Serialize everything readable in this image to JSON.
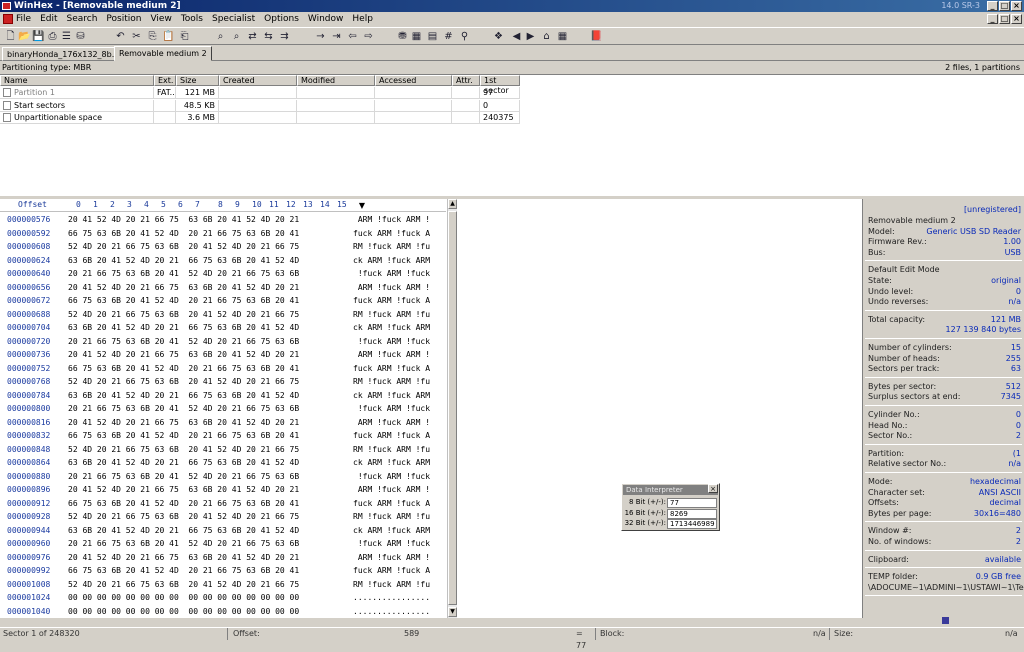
{
  "window": {
    "title": "WinHex - [Removable medium 2]",
    "version": "14.0 SR-3",
    "min": "_",
    "max": "□",
    "close": "×"
  },
  "menu": [
    "File",
    "Edit",
    "Search",
    "Position",
    "View",
    "Tools",
    "Specialist",
    "Options",
    "Window",
    "Help"
  ],
  "toolbar": [
    "new-icon",
    "open-icon",
    "save-icon",
    "print-icon",
    "properties-icon",
    "open-disk-icon",
    "undo-icon",
    "cut-icon",
    "copy-icon",
    "paste-icon",
    "paste-special-icon",
    "find-icon",
    "find-hex-icon",
    "replace-icon",
    "replace-hex-icon",
    "find-next-icon",
    "goto-offset-icon",
    "goto-sector-icon",
    "goto-back-icon",
    "goto-forward-icon",
    "disk-editor-icon",
    "ram-editor-icon",
    "calculator-icon",
    "hash-icon",
    "explore-icon",
    "snapshot-icon",
    "prev-sector-icon",
    "next-sector-icon",
    "home-icon",
    "table-icon",
    "help-book-icon"
  ],
  "tabs": [
    {
      "label": "binaryHonda_176x132_8b.BIN"
    },
    {
      "label": "Removable medium 2"
    }
  ],
  "partition": {
    "type": "Partitioning type: MBR",
    "count": "2 files, 1 partitions"
  },
  "filelist": {
    "headers": [
      "Name",
      "Ext.",
      "Size",
      "Created",
      "Modified",
      "Accessed",
      "Attr.",
      "1st sector"
    ],
    "rows": [
      {
        "name": "Partition 1",
        "ext": "FAT...",
        "size": "121 MB",
        "created": "",
        "modified": "",
        "accessed": "",
        "attr": "",
        "sector": "97"
      },
      {
        "name": "Start sectors",
        "ext": "",
        "size": "48.5 KB",
        "created": "",
        "modified": "",
        "accessed": "",
        "attr": "",
        "sector": "0"
      },
      {
        "name": "Unpartitionable space",
        "ext": "",
        "size": "3.6 MB",
        "created": "",
        "modified": "",
        "accessed": "",
        "attr": "",
        "sector": "240375"
      }
    ]
  },
  "hex": {
    "offset_label": "Offset",
    "col_labels": [
      "0",
      "1",
      "2",
      "3",
      "4",
      "5",
      "6",
      "7",
      "8",
      "9",
      "10",
      "11",
      "12",
      "13",
      "14",
      "15"
    ],
    "rows": [
      {
        "off": "000000576",
        "hex": "20 41 52 4D 20 21 66 75  63 6B 20 41 52 4D 20 21",
        "txt": " ARM !fuck ARM !"
      },
      {
        "off": "000000592",
        "hex": "66 75 63 6B 20 41 52 4D  20 21 66 75 63 6B 20 41",
        "txt": "fuck ARM !fuck A"
      },
      {
        "off": "000000608",
        "hex": "52 4D 20 21 66 75 63 6B  20 41 52 4D 20 21 66 75",
        "txt": "RM !fuck ARM !fu"
      },
      {
        "off": "000000624",
        "hex": "63 6B 20 41 52 4D 20 21  66 75 63 6B 20 41 52 4D",
        "txt": "ck ARM !fuck ARM"
      },
      {
        "off": "000000640",
        "hex": "20 21 66 75 63 6B 20 41  52 4D 20 21 66 75 63 6B",
        "txt": " !fuck ARM !fuck"
      },
      {
        "off": "000000656",
        "hex": "20 41 52 4D 20 21 66 75  63 6B 20 41 52 4D 20 21",
        "txt": " ARM !fuck ARM !"
      },
      {
        "off": "000000672",
        "hex": "66 75 63 6B 20 41 52 4D  20 21 66 75 63 6B 20 41",
        "txt": "fuck ARM !fuck A"
      },
      {
        "off": "000000688",
        "hex": "52 4D 20 21 66 75 63 6B  20 41 52 4D 20 21 66 75",
        "txt": "RM !fuck ARM !fu"
      },
      {
        "off": "000000704",
        "hex": "63 6B 20 41 52 4D 20 21  66 75 63 6B 20 41 52 4D",
        "txt": "ck ARM !fuck ARM"
      },
      {
        "off": "000000720",
        "hex": "20 21 66 75 63 6B 20 41  52 4D 20 21 66 75 63 6B",
        "txt": " !fuck ARM !fuck"
      },
      {
        "off": "000000736",
        "hex": "20 41 52 4D 20 21 66 75  63 6B 20 41 52 4D 20 21",
        "txt": " ARM !fuck ARM !"
      },
      {
        "off": "000000752",
        "hex": "66 75 63 6B 20 41 52 4D  20 21 66 75 63 6B 20 41",
        "txt": "fuck ARM !fuck A"
      },
      {
        "off": "000000768",
        "hex": "52 4D 20 21 66 75 63 6B  20 41 52 4D 20 21 66 75",
        "txt": "RM !fuck ARM !fu"
      },
      {
        "off": "000000784",
        "hex": "63 6B 20 41 52 4D 20 21  66 75 63 6B 20 41 52 4D",
        "txt": "ck ARM !fuck ARM"
      },
      {
        "off": "000000800",
        "hex": "20 21 66 75 63 6B 20 41  52 4D 20 21 66 75 63 6B",
        "txt": " !fuck ARM !fuck"
      },
      {
        "off": "000000816",
        "hex": "20 41 52 4D 20 21 66 75  63 6B 20 41 52 4D 20 21",
        "txt": " ARM !fuck ARM !"
      },
      {
        "off": "000000832",
        "hex": "66 75 63 6B 20 41 52 4D  20 21 66 75 63 6B 20 41",
        "txt": "fuck ARM !fuck A"
      },
      {
        "off": "000000848",
        "hex": "52 4D 20 21 66 75 63 6B  20 41 52 4D 20 21 66 75",
        "txt": "RM !fuck ARM !fu"
      },
      {
        "off": "000000864",
        "hex": "63 6B 20 41 52 4D 20 21  66 75 63 6B 20 41 52 4D",
        "txt": "ck ARM !fuck ARM"
      },
      {
        "off": "000000880",
        "hex": "20 21 66 75 63 6B 20 41  52 4D 20 21 66 75 63 6B",
        "txt": " !fuck ARM !fuck"
      },
      {
        "off": "000000896",
        "hex": "20 41 52 4D 20 21 66 75  63 6B 20 41 52 4D 20 21",
        "txt": " ARM !fuck ARM !"
      },
      {
        "off": "000000912",
        "hex": "66 75 63 6B 20 41 52 4D  20 21 66 75 63 6B 20 41",
        "txt": "fuck ARM !fuck A"
      },
      {
        "off": "000000928",
        "hex": "52 4D 20 21 66 75 63 6B  20 41 52 4D 20 21 66 75",
        "txt": "RM !fuck ARM !fu"
      },
      {
        "off": "000000944",
        "hex": "63 6B 20 41 52 4D 20 21  66 75 63 6B 20 41 52 4D",
        "txt": "ck ARM !fuck ARM"
      },
      {
        "off": "000000960",
        "hex": "20 21 66 75 63 6B 20 41  52 4D 20 21 66 75 63 6B",
        "txt": " !fuck ARM !fuck"
      },
      {
        "off": "000000976",
        "hex": "20 41 52 4D 20 21 66 75  63 6B 20 41 52 4D 20 21",
        "txt": " ARM !fuck ARM !"
      },
      {
        "off": "000000992",
        "hex": "66 75 63 6B 20 41 52 4D  20 21 66 75 63 6B 20 41",
        "txt": "fuck ARM !fuck A"
      },
      {
        "off": "000001008",
        "hex": "52 4D 20 21 66 75 63 6B  20 41 52 4D 20 21 66 75",
        "txt": "RM !fuck ARM !fu"
      },
      {
        "off": "000001024",
        "hex": "00 00 00 00 00 00 00 00  00 00 00 00 00 00 00 00",
        "txt": "................"
      },
      {
        "off": "000001040",
        "hex": "00 00 00 00 00 00 00 00  00 00 00 00 00 00 00 00",
        "txt": "................"
      }
    ]
  },
  "side": {
    "unregistered": "[unregistered]",
    "sections": [
      [
        [
          "Removable medium 2",
          ""
        ],
        [
          "Model:",
          "Generic USB SD Reader"
        ],
        [
          "Firmware Rev.:",
          "1.00"
        ],
        [
          "Bus:",
          "USB"
        ]
      ],
      [
        [
          "Default Edit Mode",
          ""
        ],
        [
          "State:",
          "original"
        ],
        [
          "Undo level:",
          "0"
        ],
        [
          "Undo reverses:",
          "n/a"
        ]
      ],
      [
        [
          "Total capacity:",
          "121 MB"
        ],
        [
          "",
          "127 139 840 bytes"
        ]
      ],
      [
        [
          "Number of cylinders:",
          "15"
        ],
        [
          "Number of heads:",
          "255"
        ],
        [
          "Sectors per track:",
          "63"
        ]
      ],
      [
        [
          "Bytes per sector:",
          "512"
        ],
        [
          "Surplus sectors at end:",
          "7345"
        ]
      ],
      [
        [
          "Cylinder No.:",
          "0"
        ],
        [
          "Head No.:",
          "0"
        ],
        [
          "Sector No.:",
          "2"
        ]
      ],
      [
        [
          "Partition:",
          "(1"
        ],
        [
          "Relative sector No.:",
          "n/a"
        ]
      ],
      [
        [
          "Mode:",
          "hexadecimal"
        ],
        [
          "Character set:",
          "ANSI ASCII"
        ],
        [
          "Offsets:",
          "decimal"
        ],
        [
          "Bytes per page:",
          "30x16=480"
        ]
      ],
      [
        [
          "Window #:",
          "2"
        ],
        [
          "No. of windows:",
          "2"
        ]
      ],
      [
        [
          "Clipboard:",
          "available"
        ]
      ],
      [
        [
          "TEMP folder:",
          "0.9 GB free"
        ],
        [
          "\\ADOCUME~1\\ADMINI~1\\USTAWI~1\\Temp",
          ""
        ]
      ]
    ]
  },
  "data_interpreter": {
    "title": "Data Interpreter",
    "rows": [
      {
        "label": "8 Bit (+/-):",
        "value": "77"
      },
      {
        "label": "16 Bit (+/-):",
        "value": "8269"
      },
      {
        "label": "32 Bit (+/-):",
        "value": "1713446989"
      }
    ]
  },
  "status": {
    "sector": "Sector 1 of 248320",
    "offset_label": "Offset:",
    "offset": "589",
    "eq": "= 77",
    "block_label": "Block:",
    "block": "n/a",
    "size_label": "Size:",
    "size": "n/a"
  }
}
